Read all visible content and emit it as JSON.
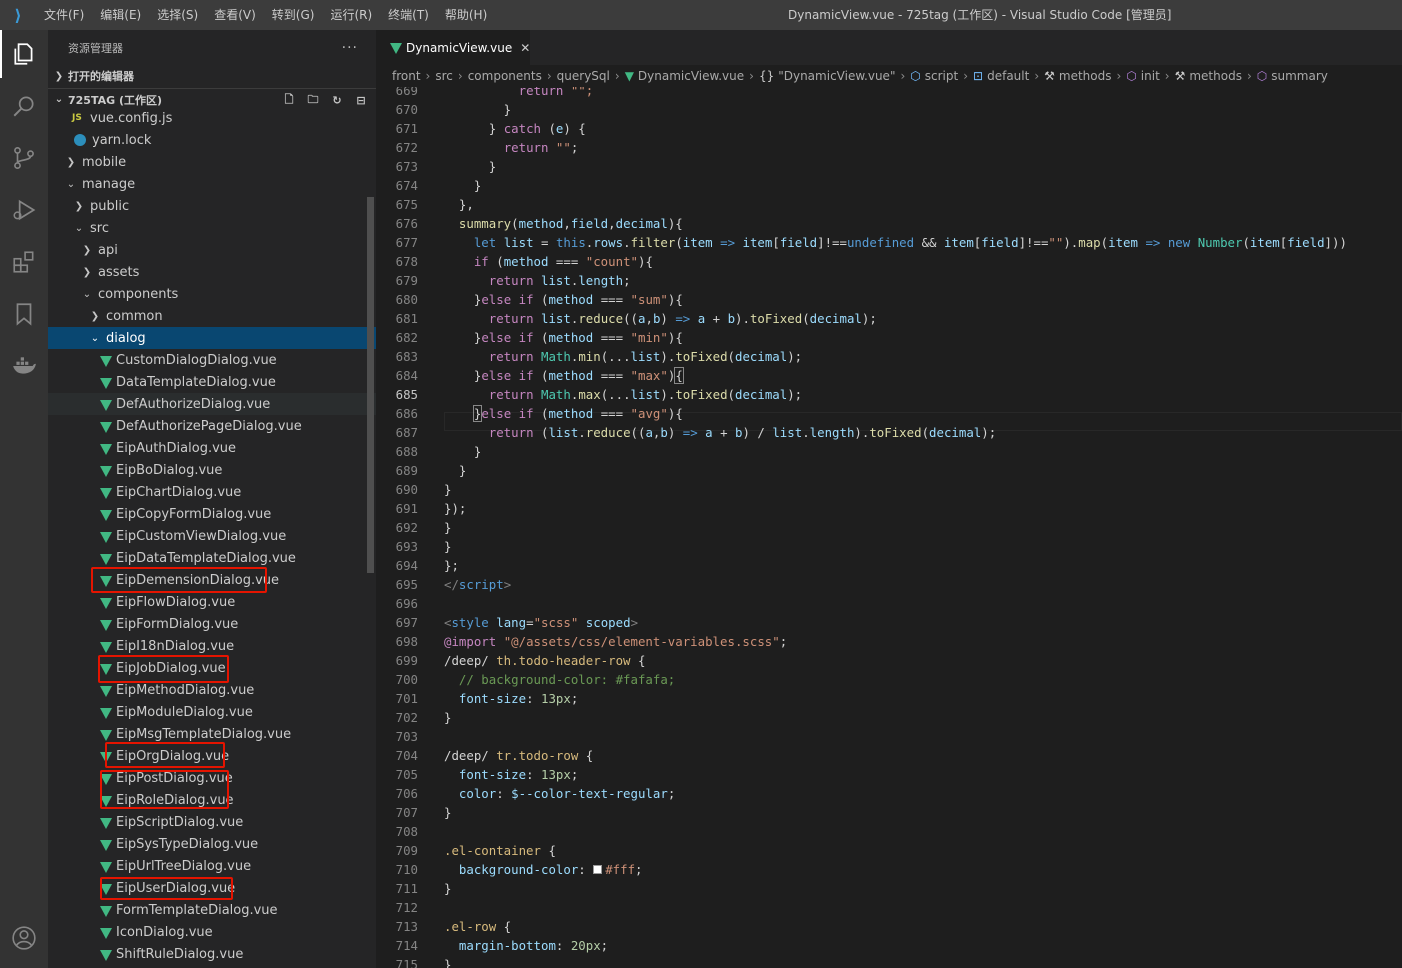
{
  "titlebar": {
    "menus": [
      "文件(F)",
      "编辑(E)",
      "选择(S)",
      "查看(V)",
      "转到(G)",
      "运行(R)",
      "终端(T)",
      "帮助(H)"
    ],
    "window_title": "DynamicView.vue - 725tag (工作区) - Visual Studio Code [管理员]"
  },
  "sidebar": {
    "title": "资源管理器",
    "more": "···",
    "open_editors": "打开的编辑器",
    "workspace": "725TAG (工作区)",
    "items": [
      {
        "label": "vue.config.js",
        "icon": "js-icon"
      },
      {
        "label": "yarn.lock",
        "icon": "yarn-icon"
      },
      {
        "label": "mobile",
        "icon": "chevron-right-icon"
      },
      {
        "label": "manage",
        "icon": "chevron-down-icon"
      },
      {
        "label": "public",
        "icon": "chevron-right-icon"
      },
      {
        "label": "src",
        "icon": "chevron-down-icon"
      },
      {
        "label": "api",
        "icon": "chevron-right-icon"
      },
      {
        "label": "assets",
        "icon": "chevron-right-icon"
      },
      {
        "label": "components",
        "icon": "chevron-down-icon"
      },
      {
        "label": "common",
        "icon": "chevron-right-icon"
      },
      {
        "label": "dialog",
        "icon": "chevron-down-icon"
      }
    ],
    "files": [
      "CustomDialogDialog.vue",
      "DataTemplateDialog.vue",
      "DefAuthorizeDialog.vue",
      "DefAuthorizePageDialog.vue",
      "EipAuthDialog.vue",
      "EipBoDialog.vue",
      "EipChartDialog.vue",
      "EipCopyFormDialog.vue",
      "EipCustomViewDialog.vue",
      "EipDataTemplateDialog.vue",
      "EipDemensionDialog.vue",
      "EipFlowDialog.vue",
      "EipFormDialog.vue",
      "EipI18nDialog.vue",
      "EipJobDialog.vue",
      "EipMethodDialog.vue",
      "EipModuleDialog.vue",
      "EipMsgTemplateDialog.vue",
      "EipOrgDialog.vue",
      "EipPostDialog.vue",
      "EipRoleDialog.vue",
      "EipScriptDialog.vue",
      "EipSysTypeDialog.vue",
      "EipUrlTreeDialog.vue",
      "EipUserDialog.vue",
      "FormTemplateDialog.vue",
      "IconDialog.vue",
      "ShiftRuleDialog.vue"
    ]
  },
  "editor": {
    "tab_label": "DynamicView.vue",
    "breadcrumb": [
      "front",
      "src",
      "components",
      "querySql",
      "DynamicView.vue",
      "\"DynamicView.vue\"",
      "script",
      "default",
      "methods",
      "init",
      "methods",
      "summary"
    ],
    "current_line": "685"
  }
}
